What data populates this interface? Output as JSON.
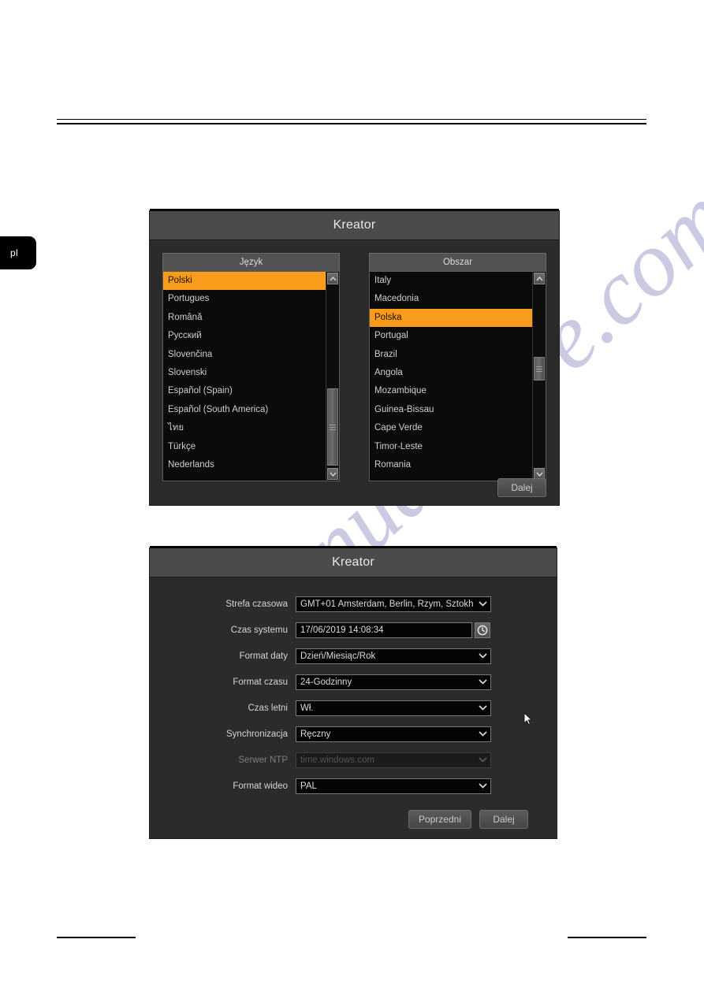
{
  "page": {
    "language_tab": "pl"
  },
  "watermark": {
    "text": "manualshive.com"
  },
  "wizard_language": {
    "title": "Kreator",
    "language_list": {
      "header": "Język",
      "items": [
        {
          "label": "Polski",
          "selected": true
        },
        {
          "label": "Portugues",
          "selected": false
        },
        {
          "label": "Română",
          "selected": false
        },
        {
          "label": "Русский",
          "selected": false
        },
        {
          "label": "Slovenčina",
          "selected": false
        },
        {
          "label": "Slovenski",
          "selected": false
        },
        {
          "label": "Español (Spain)",
          "selected": false
        },
        {
          "label": "Español (South America)",
          "selected": false
        },
        {
          "label": "ไทย",
          "selected": false
        },
        {
          "label": "Türkçe",
          "selected": false
        },
        {
          "label": "Nederlands",
          "selected": false
        }
      ]
    },
    "area_list": {
      "header": "Obszar",
      "items": [
        {
          "label": "Italy",
          "selected": false
        },
        {
          "label": "Macedonia",
          "selected": false
        },
        {
          "label": "Polska",
          "selected": true
        },
        {
          "label": "Portugal",
          "selected": false
        },
        {
          "label": "Brazil",
          "selected": false
        },
        {
          "label": "Angola",
          "selected": false
        },
        {
          "label": "Mozambique",
          "selected": false
        },
        {
          "label": "Guinea-Bissau",
          "selected": false
        },
        {
          "label": "Cape Verde",
          "selected": false
        },
        {
          "label": "Timor-Leste",
          "selected": false
        },
        {
          "label": "Romania",
          "selected": false
        }
      ]
    },
    "next_button": "Dalej"
  },
  "wizard_time": {
    "title": "Kreator",
    "fields": [
      {
        "label": "Strefa czasowa",
        "value": "GMT+01 Amsterdam, Berlin, Rzym, Sztokh",
        "type": "select",
        "disabled": false
      },
      {
        "label": "Czas systemu",
        "value": "17/06/2019 14:08:34",
        "type": "text",
        "disabled": false
      },
      {
        "label": "Format daty",
        "value": "Dzień/Miesiąc/Rok",
        "type": "select",
        "disabled": false
      },
      {
        "label": "Format czasu",
        "value": "24-Godzinny",
        "type": "select",
        "disabled": false
      },
      {
        "label": "Czas letni",
        "value": "Wł.",
        "type": "select",
        "disabled": false
      },
      {
        "label": "Synchronizacja",
        "value": "Ręczny",
        "type": "select",
        "disabled": false
      },
      {
        "label": "Serwer NTP",
        "value": "time.windows.com",
        "type": "select",
        "disabled": true
      },
      {
        "label": "Format wideo",
        "value": "PAL",
        "type": "select",
        "disabled": false
      }
    ],
    "prev_button": "Poprzedni",
    "next_button": "Dalej"
  },
  "colors": {
    "accent": "#fa9c1b",
    "dialog_bg": "#2b2b2b",
    "title_bar": "#4b4b4b",
    "list_bg": "#0a0a0a"
  }
}
